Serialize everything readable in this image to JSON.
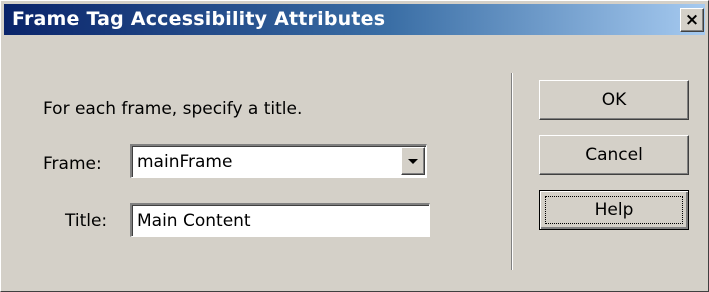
{
  "dialog": {
    "title": "Frame Tag Accessibility Attributes",
    "close_glyph": "×",
    "instruction": "For each frame, specify a title.",
    "frame_label": "Frame:",
    "frame_value": "mainFrame",
    "title_label": "Title:",
    "title_value": "Main Content"
  },
  "buttons": {
    "ok": "OK",
    "cancel": "Cancel",
    "help": "Help"
  },
  "colors": {
    "face": "#d4d0c8",
    "titlebar_start": "#0a246a",
    "titlebar_end": "#a6caf0"
  },
  "icons": {
    "close": "close-icon",
    "dropdown": "chevron-down-icon"
  }
}
